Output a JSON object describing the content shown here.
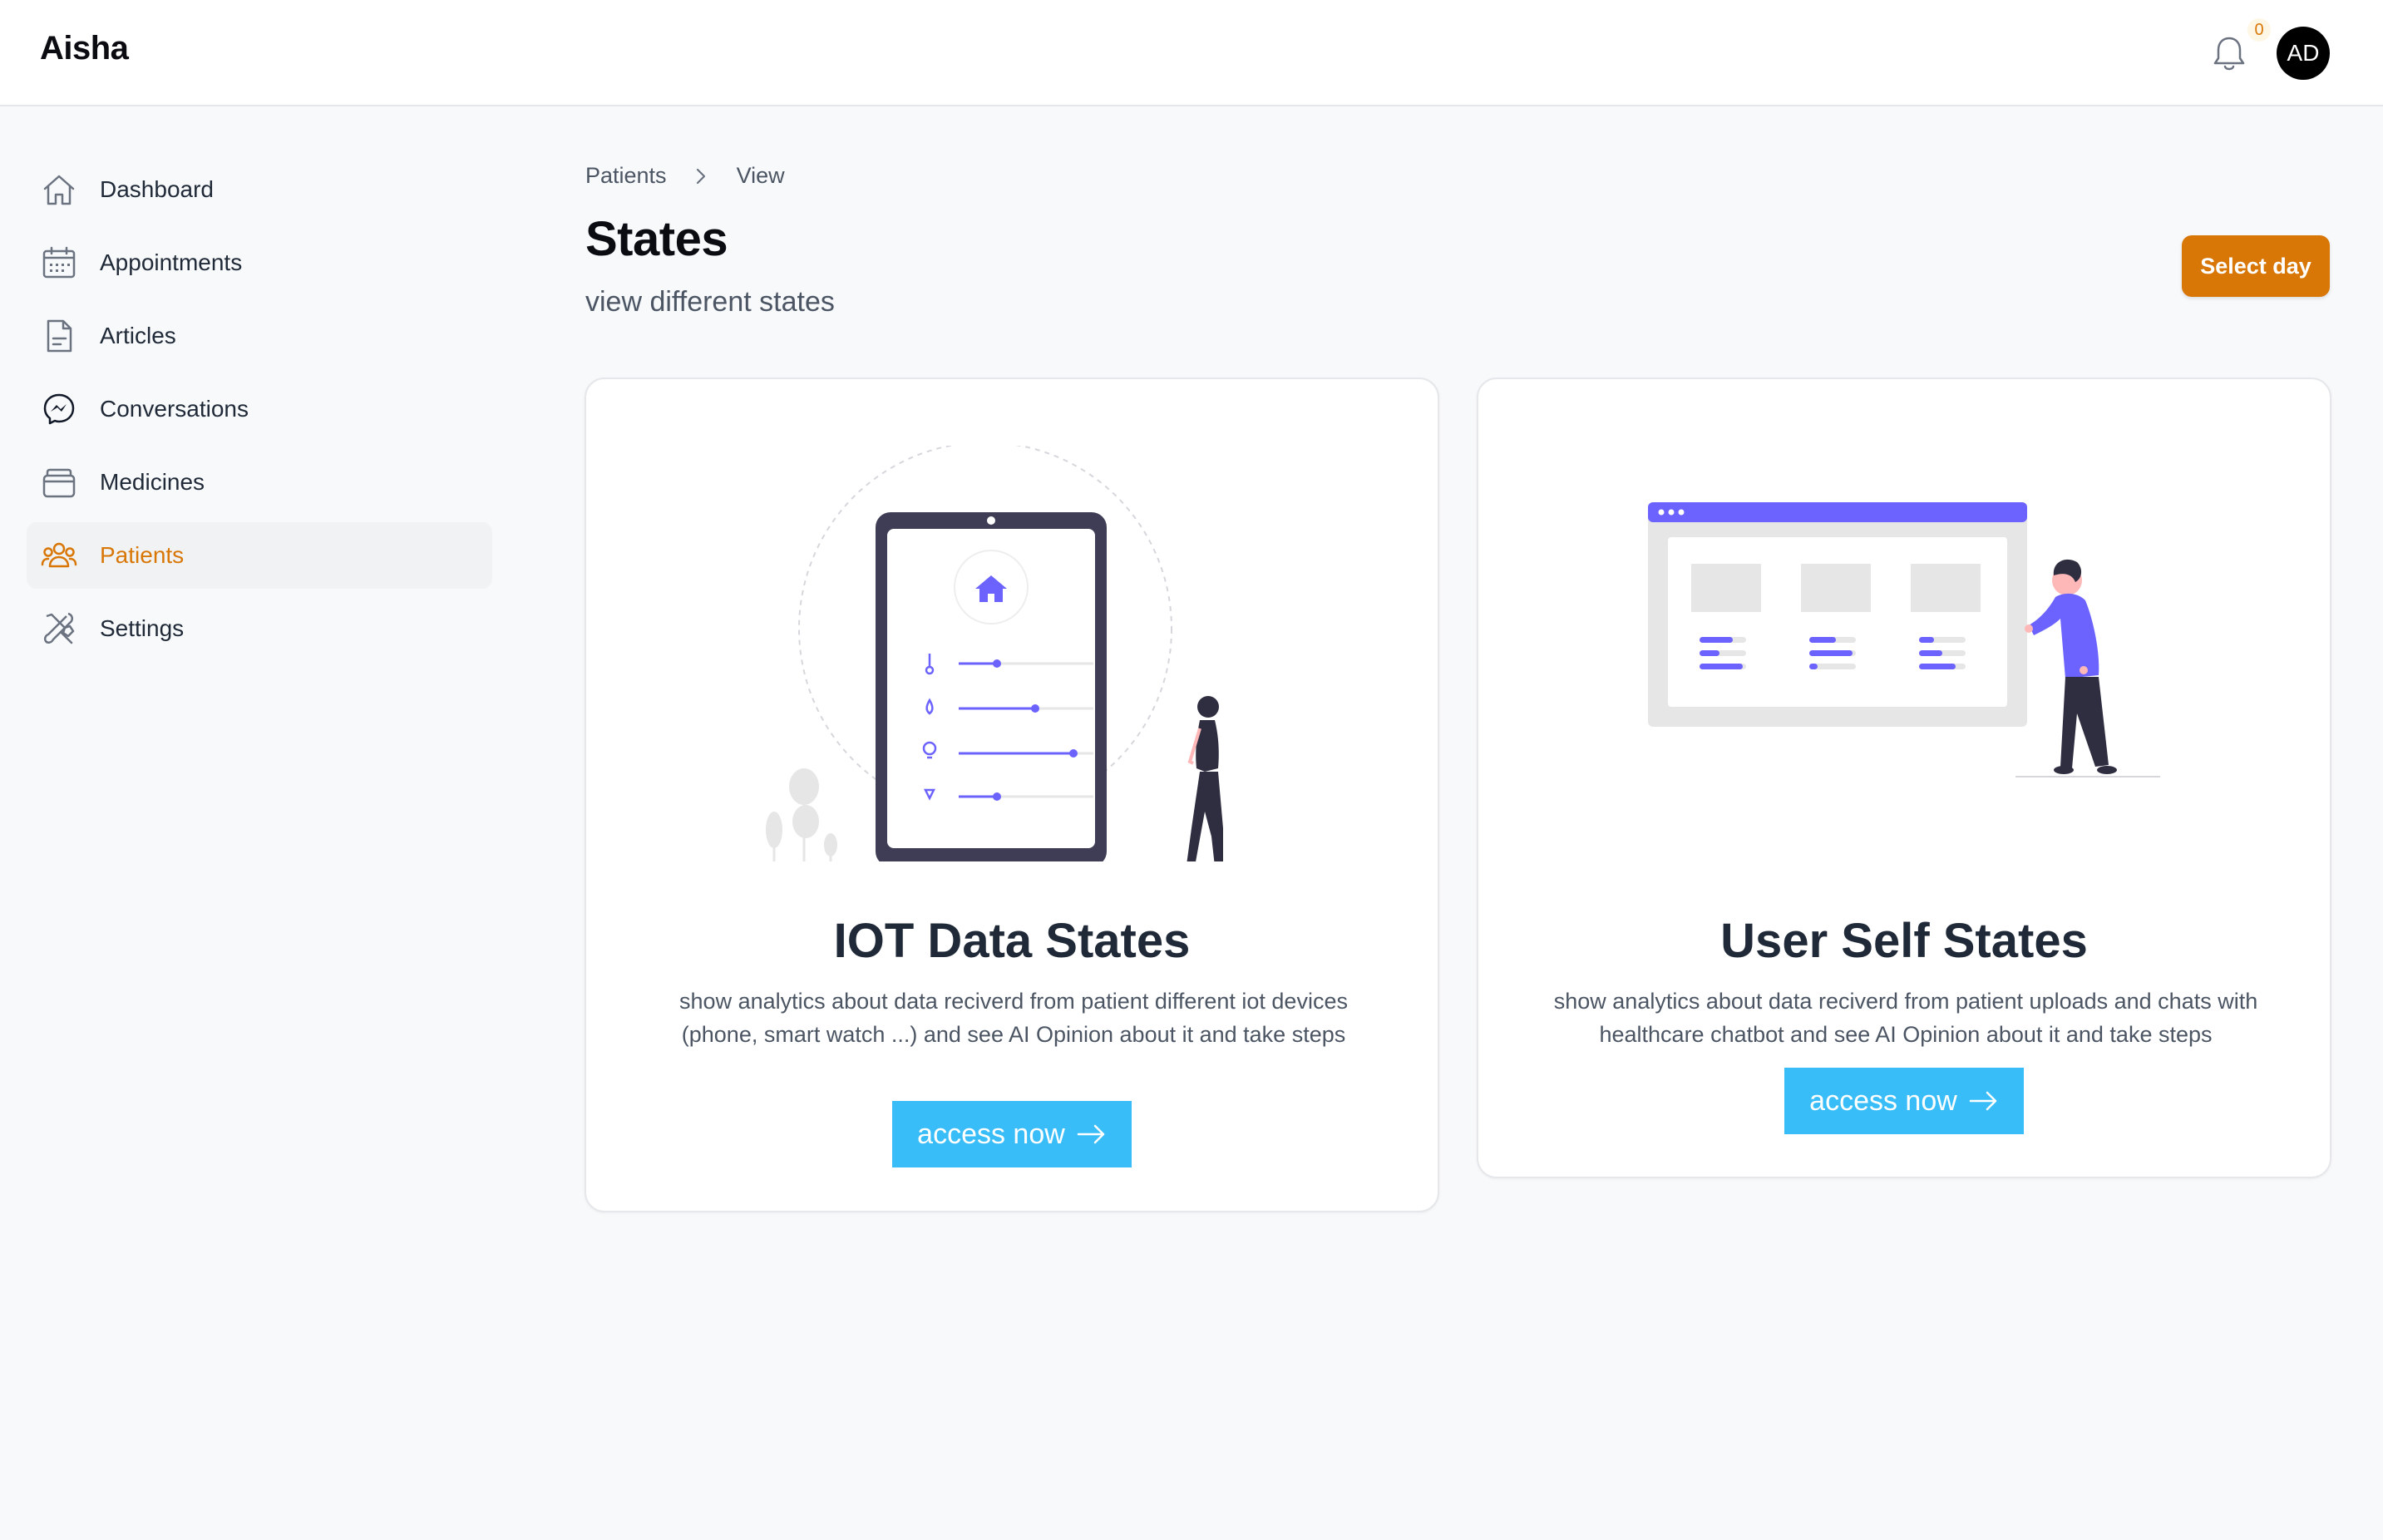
{
  "app": {
    "brand": "Aisha"
  },
  "header": {
    "notifications_count": "0",
    "avatar_initials": "AD"
  },
  "sidebar": {
    "items": [
      {
        "label": "Dashboard",
        "icon": "home-icon",
        "active": false
      },
      {
        "label": "Appointments",
        "icon": "calendar-icon",
        "active": false
      },
      {
        "label": "Articles",
        "icon": "document-icon",
        "active": false
      },
      {
        "label": "Conversations",
        "icon": "messenger-icon",
        "active": false
      },
      {
        "label": "Medicines",
        "icon": "pillbox-icon",
        "active": false
      },
      {
        "label": "Patients",
        "icon": "users-icon",
        "active": true
      },
      {
        "label": "Settings",
        "icon": "tools-icon",
        "active": false
      }
    ]
  },
  "breadcrumb": {
    "items": [
      "Patients",
      "View"
    ]
  },
  "page": {
    "title": "States",
    "subtitle": "view different states",
    "select_day_label": "Select day"
  },
  "cards": [
    {
      "title": "IOT Data States",
      "description": "show analytics about data reciverd from patient different iot devices (phone, smart watch ...) and see AI Opinion about it and take steps",
      "button_label": "access now"
    },
    {
      "title": "User Self States",
      "description": "show analytics about data reciverd from patient uploads and chats with healthcare chatbot and see AI Opinion about it and take steps",
      "button_label": "access now"
    }
  ],
  "colors": {
    "accent": "#d97706",
    "button": "#38bdf8",
    "illustration": "#6c63ff",
    "dark": "#3f3d56"
  }
}
